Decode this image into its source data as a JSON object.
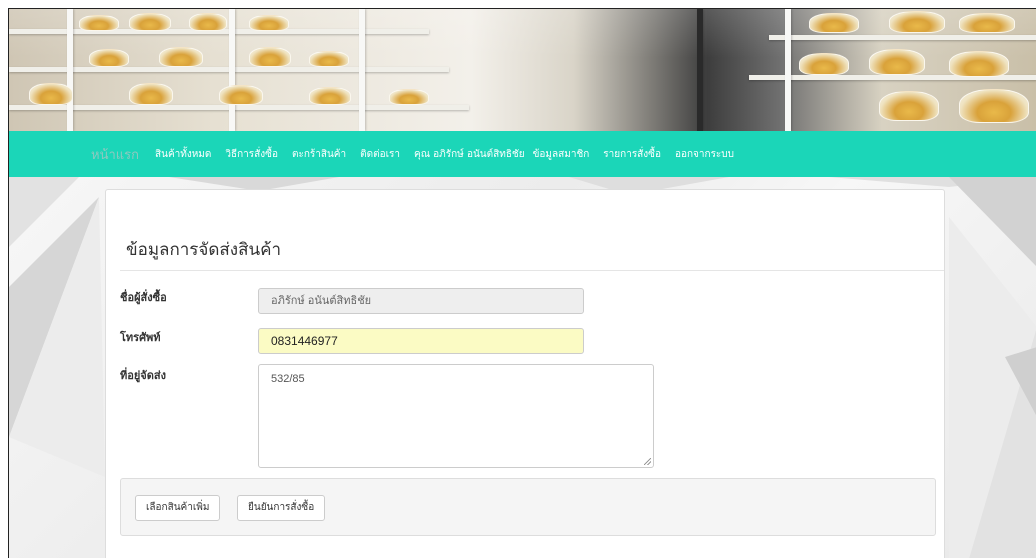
{
  "nav": {
    "items": [
      {
        "label": "หน้าแรก"
      },
      {
        "label": "สินค้าทั้งหมด"
      },
      {
        "label": "วิธีการสั่งซื้อ"
      },
      {
        "label": "ตะกร้าสินค้า"
      },
      {
        "label": "ติดต่อเรา"
      },
      {
        "label": "คุณ อภิรักษ์ อนันต์สิทธิชัย"
      },
      {
        "label": "ข้อมูลสมาชิก"
      },
      {
        "label": "รายการสั่งซื้อ"
      },
      {
        "label": "ออกจากระบบ"
      }
    ],
    "active_color": "#8cc9bf",
    "background": "#1bd6b8"
  },
  "form": {
    "title": "ข้อมูลการจัดส่งสินค้า",
    "buyer_label": "ชื่อผู้สั่งซื้อ",
    "buyer_value": "อภิรักษ์ อนันต์สิทธิชัย",
    "phone_label": "โทรศัพท์",
    "phone_value": "0831446977",
    "address_label": "ที่อยู่จัดส่ง",
    "address_value": "532/85"
  },
  "actions": {
    "more_label": "เลือกสินค้าเพิ่ม",
    "confirm_label": "ยืนยันการสั่งซื้อ"
  }
}
